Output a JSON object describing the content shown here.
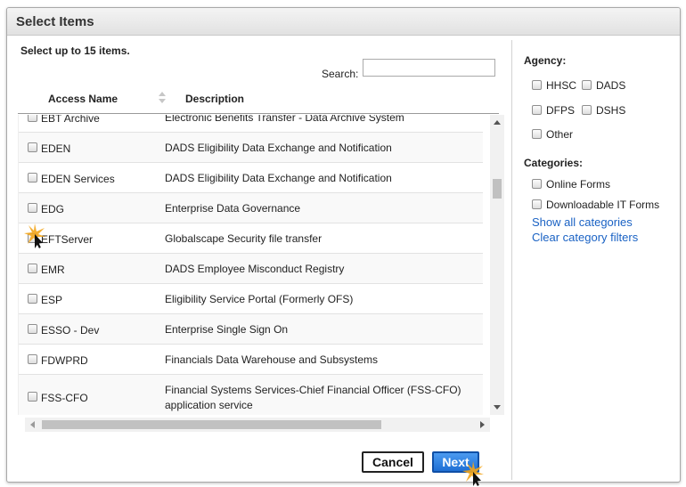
{
  "dialog": {
    "title": "Select Items"
  },
  "left": {
    "instruction": "Select up to 15 items.",
    "search": {
      "label": "Search:",
      "value": "",
      "placeholder": ""
    },
    "columns": {
      "access": "Access Name",
      "description": "Description"
    },
    "rows": [
      {
        "name": "EBT Archive",
        "description": "Electronic Benefits Transfer - Data Archive System"
      },
      {
        "name": "EDEN",
        "description": "DADS Eligibility Data Exchange and Notification"
      },
      {
        "name": "EDEN Services",
        "description": "DADS Eligibility Data Exchange and Notification"
      },
      {
        "name": "EDG",
        "description": "Enterprise Data Governance"
      },
      {
        "name": "EFTServer",
        "description": "Globalscape Security file transfer"
      },
      {
        "name": "EMR",
        "description": "DADS Employee Misconduct Registry"
      },
      {
        "name": "ESP",
        "description": "Eligibility Service Portal (Formerly OFS)"
      },
      {
        "name": "ESSO - Dev",
        "description": "Enterprise Single Sign On"
      },
      {
        "name": "FDWPRD",
        "description": "Financials Data Warehouse and Subsystems"
      },
      {
        "name": "FSS-CFO",
        "description": "Financial Systems Services-Chief Financial Officer (FSS-CFO) application service"
      }
    ]
  },
  "right": {
    "agency_title": "Agency:",
    "agencies": [
      "HHSC",
      "DADS",
      "DFPS",
      "DSHS",
      "Other"
    ],
    "categories_title": "Categories:",
    "categories": [
      "Online Forms",
      "Downloadable IT Forms"
    ],
    "show_all": "Show all categories",
    "clear": "Clear category filters"
  },
  "buttons": {
    "cancel": "Cancel",
    "next": "Next"
  }
}
